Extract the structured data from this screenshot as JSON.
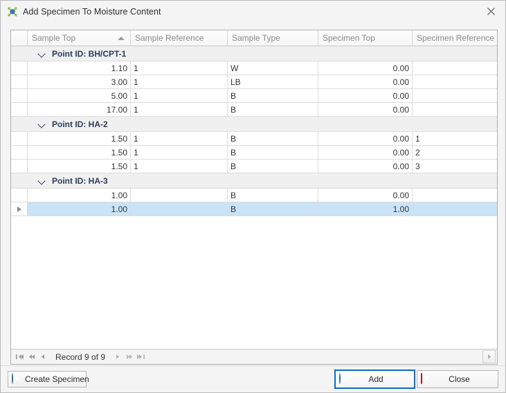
{
  "window": {
    "title": "Add Specimen To Moisture Content",
    "icon": "molecule-icon",
    "close_icon": "close-icon"
  },
  "grid": {
    "columns": [
      {
        "key": "sample_top",
        "label": "Sample Top",
        "align": "right",
        "sorted": "asc"
      },
      {
        "key": "sample_reference",
        "label": "Sample Reference",
        "align": "left",
        "sorted": ""
      },
      {
        "key": "sample_type",
        "label": "Sample Type",
        "align": "left",
        "sorted": ""
      },
      {
        "key": "specimen_top",
        "label": "Specimen Top",
        "align": "right",
        "sorted": ""
      },
      {
        "key": "specimen_reference",
        "label": "Specimen Reference",
        "align": "left",
        "sorted": ""
      }
    ],
    "groups": [
      {
        "label": "Point ID: BH/CPT-1",
        "expanded": true,
        "rows": [
          {
            "sample_top": "1.10",
            "sample_reference": "1",
            "sample_type": "W",
            "specimen_top": "0.00",
            "specimen_reference": "",
            "selected": false
          },
          {
            "sample_top": "3.00",
            "sample_reference": "1",
            "sample_type": "LB",
            "specimen_top": "0.00",
            "specimen_reference": "",
            "selected": false
          },
          {
            "sample_top": "5.00",
            "sample_reference": "1",
            "sample_type": "B",
            "specimen_top": "0.00",
            "specimen_reference": "",
            "selected": false
          },
          {
            "sample_top": "17.00",
            "sample_reference": "1",
            "sample_type": "B",
            "specimen_top": "0.00",
            "specimen_reference": "",
            "selected": false
          }
        ]
      },
      {
        "label": "Point ID: HA-2",
        "expanded": true,
        "rows": [
          {
            "sample_top": "1.50",
            "sample_reference": "1",
            "sample_type": "B",
            "specimen_top": "0.00",
            "specimen_reference": "1",
            "selected": false
          },
          {
            "sample_top": "1.50",
            "sample_reference": "1",
            "sample_type": "B",
            "specimen_top": "0.00",
            "specimen_reference": "2",
            "selected": false
          },
          {
            "sample_top": "1.50",
            "sample_reference": "1",
            "sample_type": "B",
            "specimen_top": "0.00",
            "specimen_reference": "3",
            "selected": false
          }
        ]
      },
      {
        "label": "Point ID: HA-3",
        "expanded": true,
        "rows": [
          {
            "sample_top": "1.00",
            "sample_reference": "",
            "sample_type": "B",
            "specimen_top": "0.00",
            "specimen_reference": "",
            "selected": false
          },
          {
            "sample_top": "1.00",
            "sample_reference": "",
            "sample_type": "B",
            "specimen_top": "1.00",
            "specimen_reference": "",
            "selected": true
          }
        ]
      }
    ]
  },
  "navigator": {
    "first_label": "first-record",
    "prev_page_label": "previous-page",
    "prev_label": "previous-record",
    "record_label": "Record 9 of 9",
    "next_label": "next-record",
    "next_page_label": "next-page",
    "last_label": "last-record",
    "scroll_right_label": "scroll-right"
  },
  "buttons": {
    "create_specimen": {
      "label": "Create Specimen",
      "icon": "plus-circle-icon"
    },
    "add": {
      "label": "Add",
      "icon": "plus-circle-icon",
      "focused": true
    },
    "close": {
      "label": "Close",
      "icon": "red-x-icon"
    }
  },
  "colors": {
    "selection": "#cbe3f7",
    "focus_border": "#0a6cc4",
    "group_text": "#2a3c5c",
    "header_text": "#8a8a8a"
  }
}
